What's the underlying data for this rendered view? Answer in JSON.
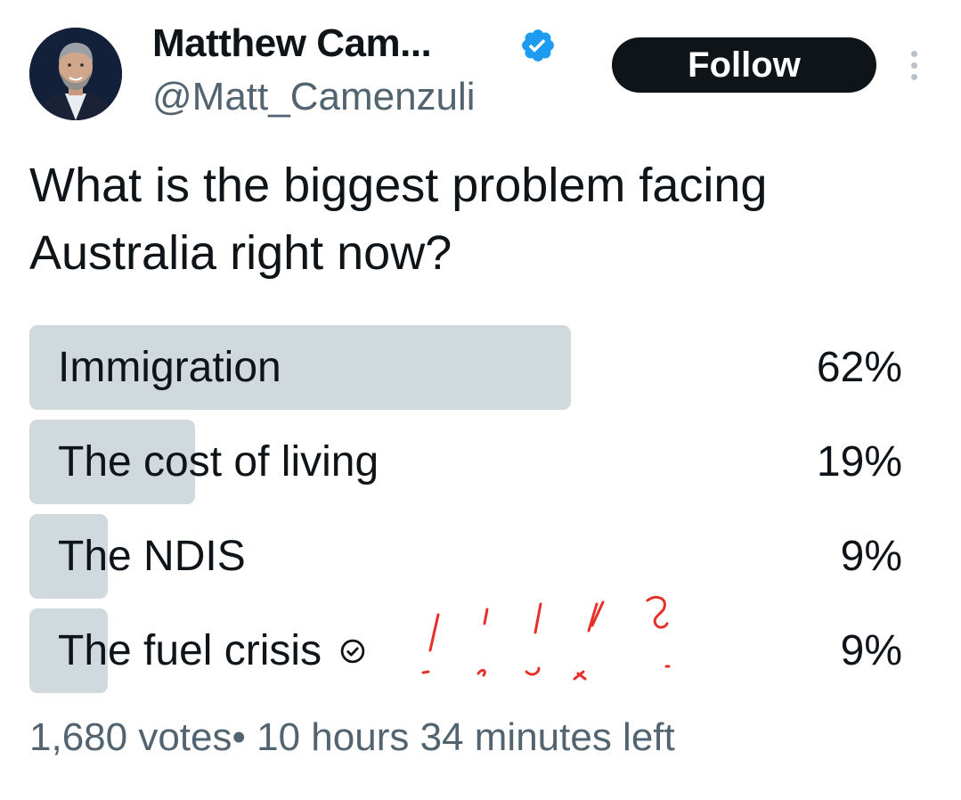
{
  "author": {
    "display_name": "Matthew Cam...",
    "handle": "@Matt_Camenzuli",
    "verified": true,
    "verified_icon": "verified-badge-icon",
    "verified_color": "#1d9bf0"
  },
  "follow_label": "Follow",
  "more_icon": "more-vertical-icon",
  "poll": {
    "question": "What is the biggest problem facing Australia right now?",
    "bar_color": "#cfd9de",
    "options": [
      {
        "label": "Immigration",
        "percent_label": "62%",
        "percent": 62
      },
      {
        "label": "The cost of living",
        "percent_label": "19%",
        "percent": 19
      },
      {
        "label": "The NDIS",
        "percent_label": "9%",
        "percent": 9
      },
      {
        "label": "The fuel crisis",
        "percent_label": "9%",
        "percent": 9,
        "selected": true,
        "selected_icon": "check-circle-icon"
      }
    ],
    "votes": "1,680 votes",
    "separator": "•",
    "time_left": "10 hours 34 minutes left"
  },
  "annotation": {
    "icon": "handwritten-exclamation-question-marks",
    "color": "#e8302b"
  }
}
